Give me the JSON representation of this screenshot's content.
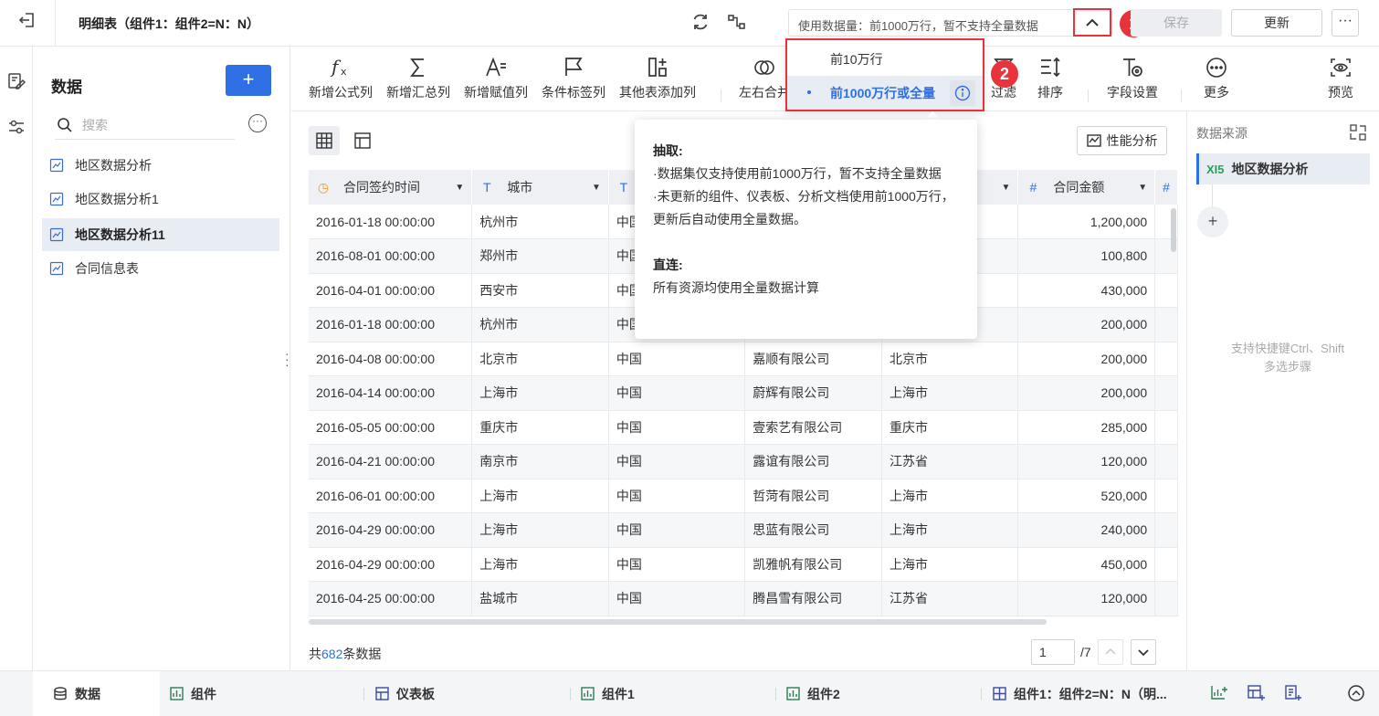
{
  "header": {
    "back_icon": "exit-icon",
    "title": "明细表（组件1：组件2=N：N）",
    "usage_text": "使用数据量：前1000万行，暂不支持全量数据",
    "badge1": "1",
    "badge2": "2",
    "save_label": "保存",
    "update_label": "更新",
    "more_label": "···"
  },
  "left_panel": {
    "title": "数据",
    "add_label": "+",
    "search_placeholder": "搜索",
    "items": [
      {
        "label": "地区数据分析"
      },
      {
        "label": "地区数据分析1"
      },
      {
        "label": "地区数据分析11"
      },
      {
        "label": "合同信息表"
      }
    ]
  },
  "toolbar": {
    "tools": [
      {
        "label": "新增公式列"
      },
      {
        "label": "新增汇总列"
      },
      {
        "label": "新增赋值列"
      },
      {
        "label": "条件标签列"
      },
      {
        "label": "其他表添加列"
      },
      {
        "label": "左右合并"
      },
      {
        "label": "过滤"
      },
      {
        "label": "排序"
      },
      {
        "label": "字段设置"
      },
      {
        "label": "更多"
      },
      {
        "label": "预览"
      }
    ]
  },
  "content": {
    "perf_label": "性能分析",
    "columns": [
      {
        "label": "合同签约时间"
      },
      {
        "label": "城市"
      },
      {
        "label": ""
      },
      {
        "label": ""
      },
      {
        "label": ""
      },
      {
        "label": "合同金额"
      }
    ],
    "rows": [
      [
        "2016-01-18 00:00:00",
        "杭州市",
        "中国",
        "",
        "",
        "1,200,000"
      ],
      [
        "2016-08-01 00:00:00",
        "郑州市",
        "中国",
        "",
        "",
        "100,800"
      ],
      [
        "2016-04-01 00:00:00",
        "西安市",
        "中国",
        "",
        "",
        "430,000"
      ],
      [
        "2016-01-18 00:00:00",
        "杭州市",
        "中国",
        "",
        "",
        "200,000"
      ],
      [
        "2016-04-08 00:00:00",
        "北京市",
        "中国",
        "嘉顺有限公司",
        "北京市",
        "200,000"
      ],
      [
        "2016-04-14 00:00:00",
        "上海市",
        "中国",
        "蔚辉有限公司",
        "上海市",
        "200,000"
      ],
      [
        "2016-05-05 00:00:00",
        "重庆市",
        "中国",
        "壹索艺有限公司",
        "重庆市",
        "285,000"
      ],
      [
        "2016-04-21 00:00:00",
        "南京市",
        "中国",
        "露谊有限公司",
        "江苏省",
        "120,000"
      ],
      [
        "2016-06-01 00:00:00",
        "上海市",
        "中国",
        "哲菏有限公司",
        "上海市",
        "520,000"
      ],
      [
        "2016-04-29 00:00:00",
        "上海市",
        "中国",
        "思蓝有限公司",
        "上海市",
        "240,000"
      ],
      [
        "2016-04-29 00:00:00",
        "上海市",
        "中国",
        "凯雅帆有限公司",
        "上海市",
        "450,000"
      ],
      [
        "2016-04-25 00:00:00",
        "盐城市",
        "中国",
        "腾昌雪有限公司",
        "江苏省",
        "120,000"
      ]
    ],
    "count_prefix": "共",
    "count_value": "682",
    "count_suffix": "条数据",
    "page_value": "1",
    "page_total": "/7"
  },
  "right_panel": {
    "title": "数据来源",
    "source_icon": "XI5",
    "source_label": "地区数据分析",
    "add_label": "+",
    "hint_line1": "支持快捷键Ctrl、Shift",
    "hint_line2": "多选步骤"
  },
  "dropdown": {
    "option1": "前10万行",
    "option2": "前1000万行或全量"
  },
  "tooltip": {
    "h1": "抽取:",
    "p1": "·数据集仅支持使用前1000万行，暂不支持全量数据",
    "p2": "·未更新的组件、仪表板、分析文档使用前1000万行，更新后自动使用全量数据。",
    "h2": "直连:",
    "p3": "所有资源均使用全量数据计算"
  },
  "bottom_tabs": [
    {
      "label": "数据"
    },
    {
      "label": "组件"
    },
    {
      "label": "仪表板"
    },
    {
      "label": "组件1"
    },
    {
      "label": "组件2"
    },
    {
      "label": "组件1：组件2=N：N（明..."
    }
  ],
  "colors": {
    "accent": "#2f6fe4",
    "highlight": "#e8323c",
    "excel_green": "#27a255"
  }
}
